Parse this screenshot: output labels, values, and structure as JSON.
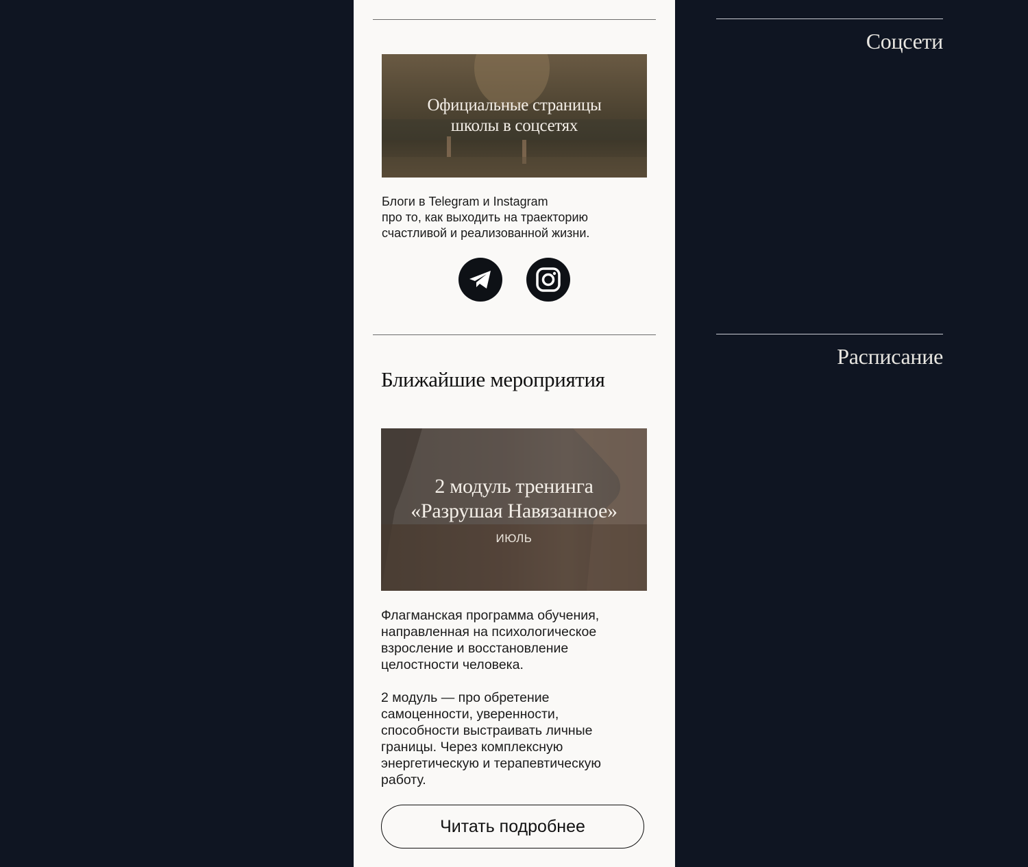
{
  "social_section": {
    "banner_title_line1": "Официальные страницы",
    "banner_title_line2": "школы в соцсетях",
    "description_line1": "Блоги в Telegram и Instagram",
    "description_line2": "про то, как выходить на траекторию",
    "description_line3": "счастливой и реализованной жизни.",
    "icons": [
      "telegram-icon",
      "instagram-icon"
    ]
  },
  "events_section": {
    "title": "Ближайшие мероприятия",
    "event": {
      "title_line1": "2 модуль тренинга",
      "title_line2": "«Разрушая Навязанное»",
      "date": "ИЮЛЬ",
      "para1_line1": "Флагманская программа обучения,",
      "para1_line2": "направленная на психологическое",
      "para1_line3": "взросление и восстановление",
      "para1_line4": "целостности человека.",
      "para2_line1": "2 модуль — про обретение",
      "para2_line2": "самоценности, уверенности,",
      "para2_line3": "способности выстраивать личные",
      "para2_line4": "границы. Через комплексную",
      "para2_line5": "энергетическую и терапевтическую",
      "para2_line6": "работу.",
      "cta_label": "Читать подробнее"
    }
  },
  "side_nav": {
    "socials_label": "Соцсети",
    "schedule_label": "Расписание"
  },
  "colors": {
    "page_bg": "#0f1522",
    "panel_bg": "#faf9f7",
    "text": "#1a1a1a",
    "icon_bg": "#0e1116"
  }
}
